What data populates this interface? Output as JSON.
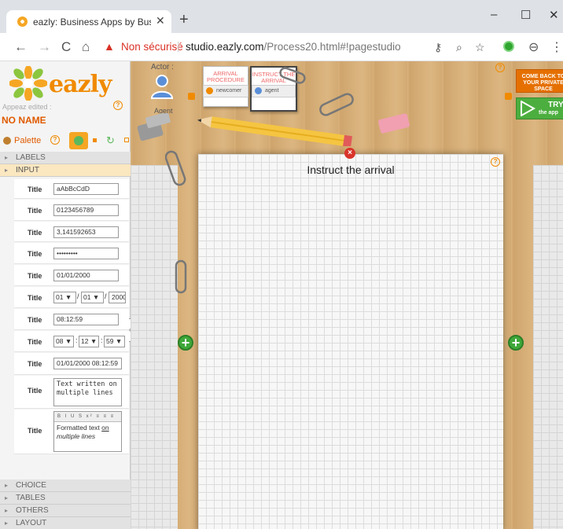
{
  "browser": {
    "tab_title": "eazly: Business Apps by Business",
    "tab_close": "✕",
    "new_tab": "+",
    "minimize": "–",
    "maximize": "☐",
    "close": "✕",
    "back": "←",
    "forward": "→",
    "reload": "C",
    "home": "⌂",
    "security_warning": "Non sécurisé",
    "url_host": "studio.eazly.com",
    "url_path": "/Process20.html#!pagestudio"
  },
  "app": {
    "logo_text": "eazly",
    "appeaz_edited": "Appeaz edited :",
    "app_name": "NO NAME",
    "palette_label": "Palette",
    "help": "?",
    "sections_top": [
      {
        "label": "LABELS"
      },
      {
        "label": "INPUT"
      }
    ],
    "sections_bottom": [
      {
        "label": "CHOICE"
      },
      {
        "label": "TABLES"
      },
      {
        "label": "OTHERS"
      },
      {
        "label": "LAYOUT"
      }
    ],
    "fields": {
      "text": {
        "label": "Title",
        "value": "aAbBcCdD"
      },
      "number": {
        "label": "Title",
        "value": "0123456789"
      },
      "decimal": {
        "label": "Title",
        "value": "3,141592653"
      },
      "password": {
        "label": "Title",
        "value": "•••••••••"
      },
      "date": {
        "label": "Title",
        "value": "01/01/2000"
      },
      "date_select": {
        "label": "Title",
        "day": "01 ▼",
        "month": "01 ▼",
        "year": "2000",
        "sep": "/"
      },
      "time": {
        "label": "Title",
        "value": "08:12:59"
      },
      "time_select": {
        "label": "Title",
        "h": "08 ▼",
        "m": "12 ▼",
        "s": "59 ▼",
        "sep": ":"
      },
      "datetime": {
        "label": "Title",
        "value": "01/01/2000 08:12:59"
      },
      "multiline": {
        "label": "Title",
        "value": "Text written on multiple lines"
      },
      "rich": {
        "label": "Title",
        "tools": "B I U S x² ≡ ≡ ≡",
        "text_normal": "Formatted text ",
        "text_underlined": "on",
        "text_italic": "multiple lines"
      }
    }
  },
  "workspace": {
    "actor_label": "Actor :",
    "agent_label": "Agent",
    "cards": [
      {
        "title": "ARRIVAL PROCEDURE",
        "tag": "newcomer"
      },
      {
        "title": "INSTRUCT THE ARRIVAL",
        "tag": "agent"
      }
    ],
    "back_button": "COME BACK TO YOUR PRIVATE SPACE",
    "try_title": "TRY",
    "try_sub": "the app",
    "page_title": "Instruct the arrival",
    "page_close": "×",
    "add_left": "+",
    "add_right": "+",
    "collapse": "«"
  },
  "colors": {
    "accent_orange": "#f08a00",
    "green": "#3fa83a",
    "danger": "#d9342b"
  }
}
